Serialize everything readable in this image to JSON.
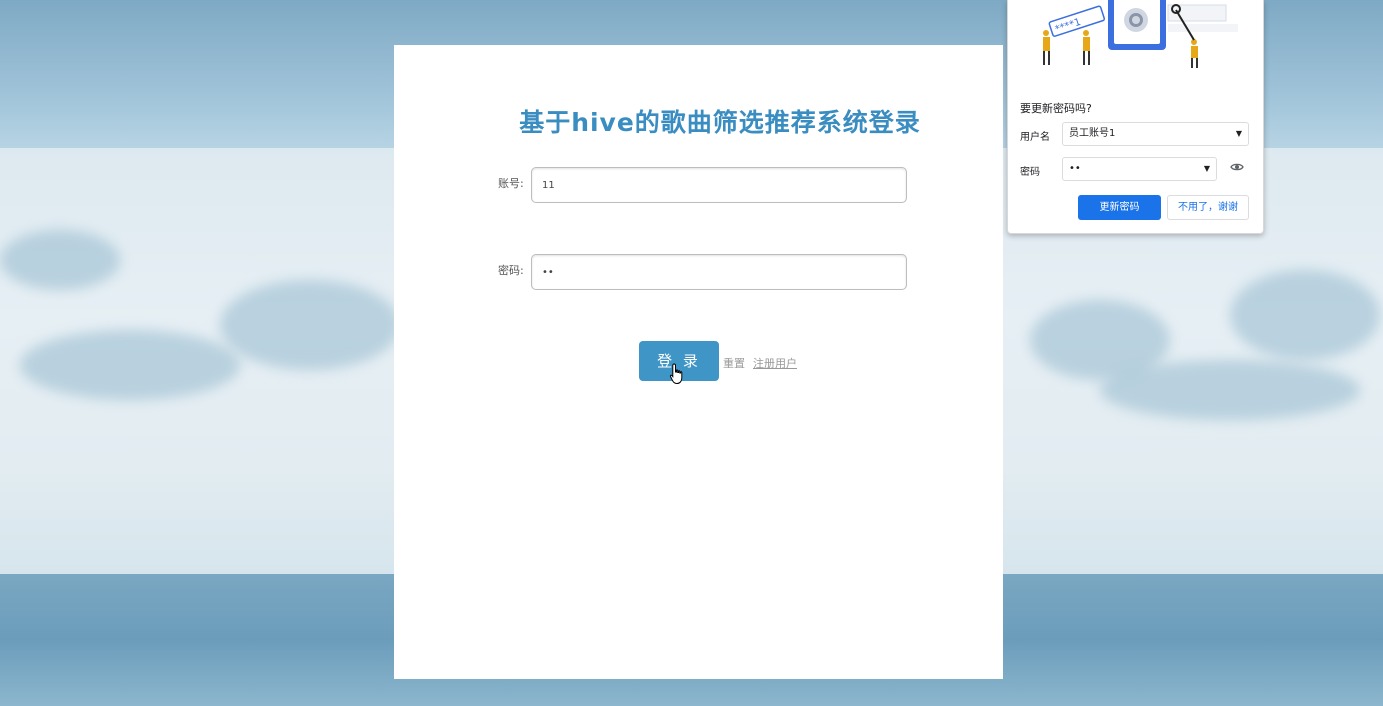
{
  "login": {
    "title": "基于hive的歌曲筛选推荐系统登录",
    "account_label": "账号:",
    "account_value": "11",
    "password_label": "密码:",
    "password_value": "••",
    "login_button": "登 录",
    "reset_link": "重置",
    "register_link": "注册用户"
  },
  "password_popup": {
    "illustration_text": "****1",
    "heading": "要更新密码吗?",
    "username_label": "用户名",
    "username_value": "员工账号1",
    "password_label": "密码",
    "password_value": "••",
    "update_button": "更新密码",
    "dismiss_button": "不用了，谢谢"
  },
  "colors": {
    "title": "#3a8dc1",
    "login_button": "#3f96c6",
    "popup_primary": "#1a73e8"
  },
  "icons": {
    "dropdown": "caret-down-icon",
    "show_password": "eye-icon",
    "cursor": "hand-pointer-icon"
  }
}
